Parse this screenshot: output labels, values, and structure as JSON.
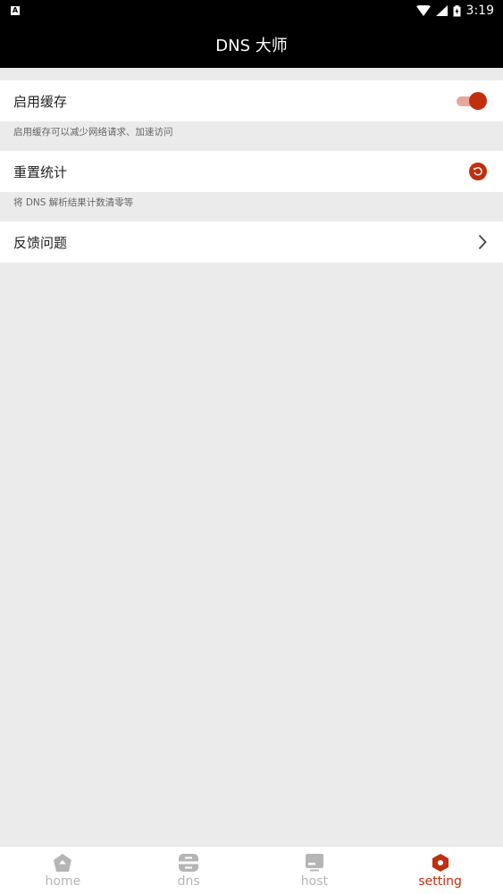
{
  "status_bar": {
    "time": "3:19",
    "notification_badge": "A"
  },
  "app_bar": {
    "title": "DNS 大师"
  },
  "settings": [
    {
      "label": "启用缓存",
      "description": "启用缓存可以减少网络请求、加速访问",
      "control": "toggle",
      "enabled": true
    },
    {
      "label": "重置统计",
      "description": "将 DNS 解析结果计数清零等",
      "control": "reset-icon"
    },
    {
      "label": "反馈问题",
      "control": "chevron-right-icon"
    }
  ],
  "tabs": [
    {
      "label": "home",
      "icon": "home-icon",
      "active": false
    },
    {
      "label": "dns",
      "icon": "dns-icon",
      "active": false
    },
    {
      "label": "host",
      "icon": "host-icon",
      "active": false
    },
    {
      "label": "setting",
      "icon": "setting-icon",
      "active": true
    }
  ],
  "colors": {
    "accent": "#c0300e",
    "toggle_track": "#e5a89d",
    "background": "#ebebeb",
    "inactive_tab": "#b5b5b5"
  }
}
